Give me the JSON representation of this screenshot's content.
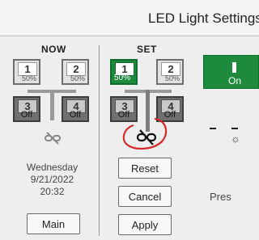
{
  "header": {
    "title": "LED Light Settings"
  },
  "now": {
    "title": "NOW",
    "channels": [
      {
        "num": "1",
        "value": "50%"
      },
      {
        "num": "2",
        "value": "50%"
      },
      {
        "num": "3",
        "value": "Off"
      },
      {
        "num": "4",
        "value": "Off"
      }
    ],
    "date": {
      "weekday": "Wednesday",
      "date": "9/21/2022",
      "time": "20:32"
    },
    "main_label": "Main"
  },
  "set": {
    "title": "SET",
    "channels": [
      {
        "num": "1",
        "value": "50%"
      },
      {
        "num": "2",
        "value": "50%"
      },
      {
        "num": "3",
        "value": "Off"
      },
      {
        "num": "4",
        "value": "Off"
      }
    ],
    "reset_label": "Reset",
    "cancel_label": "Cancel",
    "apply_label": "Apply"
  },
  "right": {
    "on_label": "On",
    "pres_text": "Pres"
  },
  "colors": {
    "active_green": "#1e8a3c",
    "annotation_red": "#d42a2a"
  }
}
